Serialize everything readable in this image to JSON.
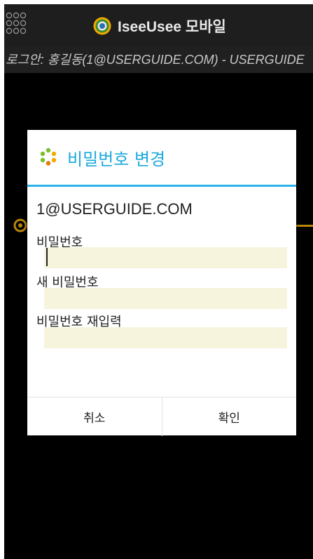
{
  "app": {
    "grid_icon": "grid-icon",
    "logo_icon": "iseeusee-logo-icon",
    "title": "IseeUsee 모바일",
    "login_info": "로그안: 홍길동(1@USERGUIDE.COM) - USERGUIDE"
  },
  "dialog": {
    "title_icon": "spinner-icon",
    "title": "비밀번호 변경",
    "email": "1@USERGUIDE.COM",
    "fields": [
      {
        "label": "비밀번호",
        "value": ""
      },
      {
        "label": "새 비밀번호",
        "value": ""
      },
      {
        "label": "비밀번호 재입력",
        "value": ""
      }
    ],
    "cancel_label": "취소",
    "confirm_label": "확인"
  },
  "colors": {
    "accent": "#1ba9dc",
    "input_bg": "#f6f4dc",
    "background": "#000000"
  }
}
